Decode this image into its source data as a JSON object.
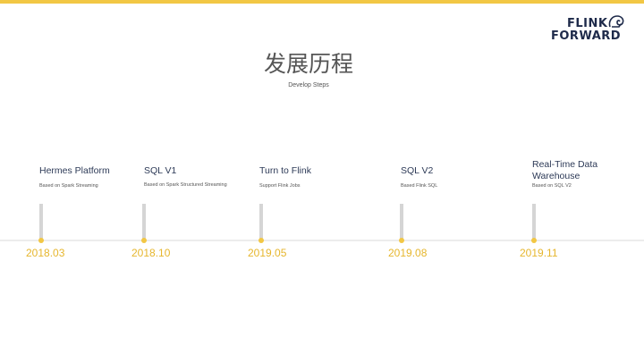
{
  "header": {
    "logo_line1": "FLINK",
    "logo_line2": "FORWARD",
    "title": "发展历程",
    "subtitle": "Develop Steps"
  },
  "colors": {
    "accent": "#f2c744",
    "year": "#e6b62d",
    "heading": "#2d3a57",
    "axis": "#ececec",
    "stem": "#d5d5d5"
  },
  "timeline": [
    {
      "title": "Hermes Platform",
      "description": "Based on Spark Streaming",
      "year": "2018.03"
    },
    {
      "title": "SQL V1",
      "description": "Based on Spark Structured Streaming",
      "year": "2018.10"
    },
    {
      "title": "Turn to Flink",
      "description": "Support Flink Jobs",
      "year": "2019.05"
    },
    {
      "title": "SQL V2",
      "description": "Based Flink SQL",
      "year": "2019.08"
    },
    {
      "title": "Real-Time Data Warehouse",
      "description": "Based on SQL V2",
      "year": "2019.11"
    }
  ]
}
